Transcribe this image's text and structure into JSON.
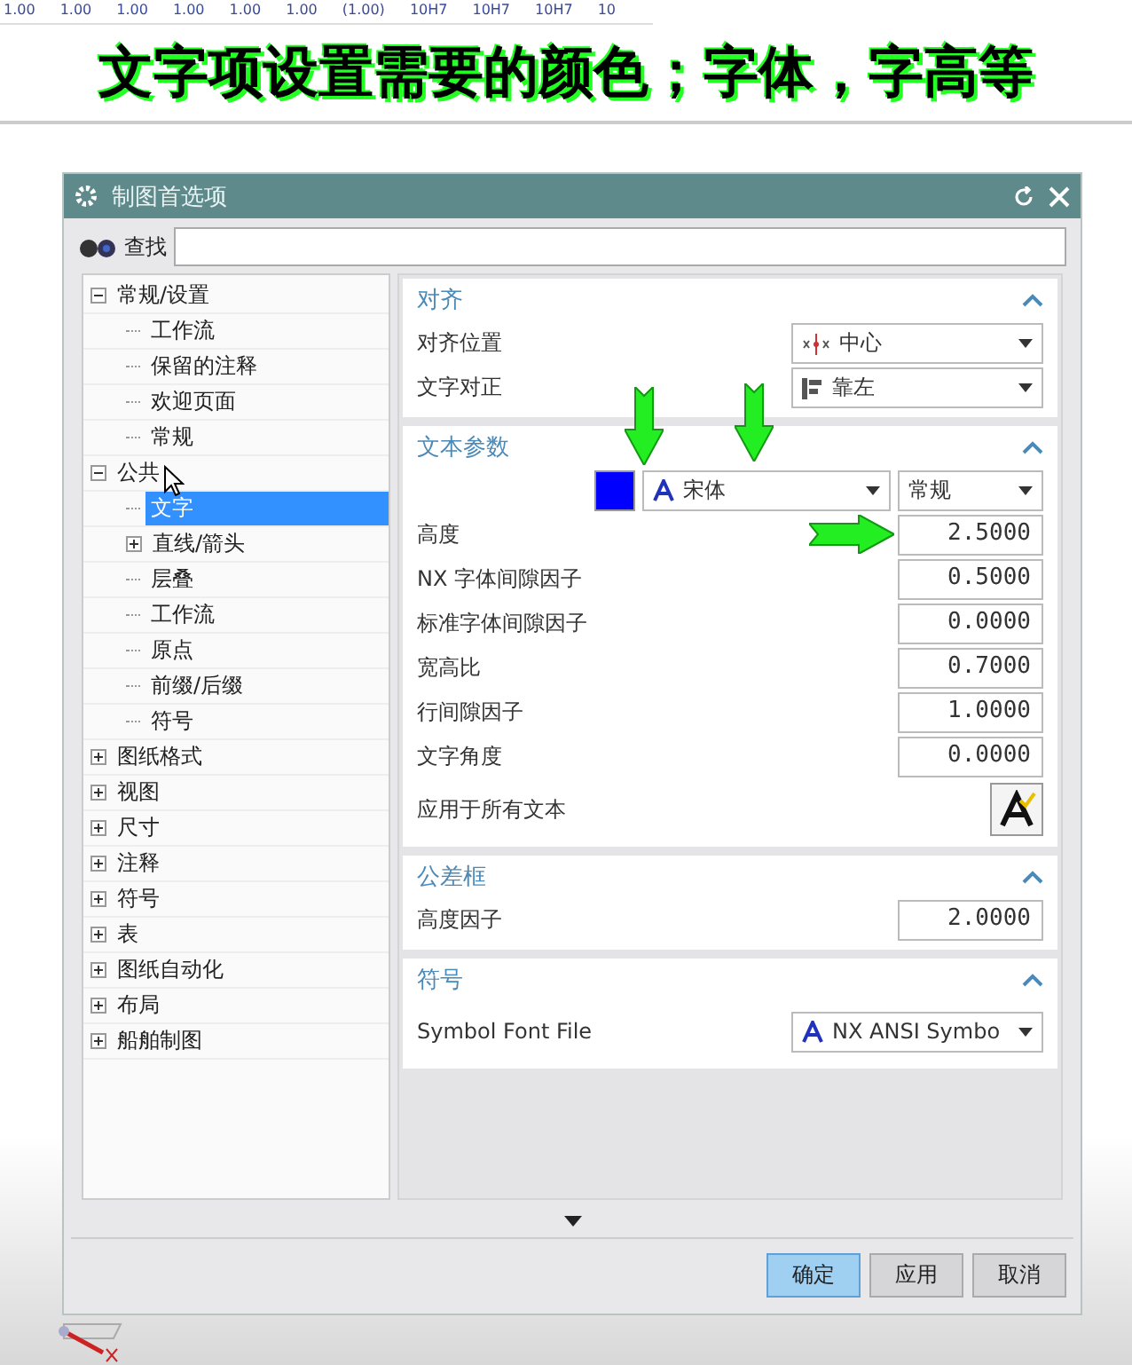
{
  "toolbar": {
    "items": [
      "1.00",
      "1.00",
      "1.00",
      "1.00",
      "1.00",
      "1.00",
      "(1.00)",
      "10H7",
      "10H7",
      "10H7",
      "10"
    ]
  },
  "caption": "文字项设置需要的颜色；字体，字高等",
  "dialog": {
    "title": "制图首选项",
    "search": {
      "label": "查找"
    },
    "tree": [
      {
        "label": "常规/设置",
        "expanded": true,
        "selected": false,
        "children": [
          {
            "label": "工作流",
            "selected": false
          },
          {
            "label": "保留的注释",
            "selected": false
          },
          {
            "label": "欢迎页面",
            "selected": false
          },
          {
            "label": "常规",
            "selected": false
          }
        ]
      },
      {
        "label": "公共",
        "expanded": true,
        "selected": false,
        "children": [
          {
            "label": "文字",
            "selected": true
          },
          {
            "label": "直线/箭头",
            "expanded": false,
            "selected": false
          },
          {
            "label": "层叠",
            "selected": false
          },
          {
            "label": "工作流",
            "selected": false
          },
          {
            "label": "原点",
            "selected": false
          },
          {
            "label": "前缀/后缀",
            "selected": false
          },
          {
            "label": "符号",
            "selected": false
          }
        ]
      },
      {
        "label": "图纸格式",
        "expanded": false,
        "selected": false
      },
      {
        "label": "视图",
        "expanded": false,
        "selected": false
      },
      {
        "label": "尺寸",
        "expanded": false,
        "selected": false
      },
      {
        "label": "注释",
        "expanded": false,
        "selected": false
      },
      {
        "label": "符号",
        "expanded": false,
        "selected": false
      },
      {
        "label": "表",
        "expanded": false,
        "selected": false
      },
      {
        "label": "图纸自动化",
        "expanded": false,
        "selected": false
      },
      {
        "label": "布局",
        "expanded": false,
        "selected": false
      },
      {
        "label": "船舶制图",
        "expanded": false,
        "selected": false
      }
    ],
    "sections": [
      {
        "title": "对齐",
        "expanded": true,
        "rows": [
          {
            "kind": "anchor",
            "label": "对齐位置",
            "value": "中心"
          },
          {
            "kind": "justify",
            "label": "文字对正",
            "value": "靠左"
          }
        ]
      },
      {
        "title": "文本参数",
        "expanded": true,
        "rows": [
          {
            "kind": "font",
            "color": "#0000ff",
            "font": "宋体",
            "style": "常规"
          },
          {
            "kind": "number",
            "label": "高度",
            "value": "2.5000"
          },
          {
            "kind": "number",
            "label": "NX 字体间隙因子",
            "value": "0.5000"
          },
          {
            "kind": "number",
            "label": "标准字体间隙因子",
            "value": "0.0000"
          },
          {
            "kind": "number",
            "label": "宽高比",
            "value": "0.7000"
          },
          {
            "kind": "number",
            "label": "行间隙因子",
            "value": "1.0000"
          },
          {
            "kind": "number",
            "label": "文字角度",
            "value": "0.0000"
          },
          {
            "kind": "apply",
            "label": "应用于所有文本"
          }
        ]
      },
      {
        "title": "公差框",
        "expanded": true,
        "rows": [
          {
            "kind": "number",
            "label": "高度因子",
            "value": "2.0000"
          }
        ]
      },
      {
        "title": "符号",
        "expanded": true,
        "rows": [
          {
            "kind": "fontfile",
            "label": "Symbol Font File",
            "value": "NX ANSI Symbo"
          }
        ]
      }
    ],
    "buttons": [
      {
        "label": "确定",
        "default": true
      },
      {
        "label": "应用",
        "default": false
      },
      {
        "label": "取消",
        "default": false
      }
    ]
  }
}
